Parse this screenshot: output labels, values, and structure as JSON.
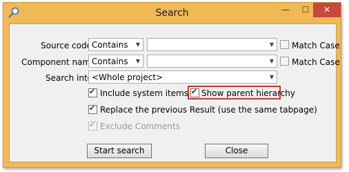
{
  "window": {
    "title": "Search",
    "icon": "search-icon"
  },
  "titlebar_buttons": {
    "minimize": "—",
    "maximize": "☐",
    "close": "✕"
  },
  "form": {
    "source_code": {
      "label": "Source code:",
      "mode": "Contains",
      "value": "",
      "match_case_label": "Match Case",
      "match_case": false
    },
    "component_name": {
      "label": "Component name:",
      "mode": "Contains",
      "value": "",
      "match_case_label": "Match Case",
      "match_case": false
    },
    "search_into": {
      "label": "Search into:",
      "value": "<Whole project>"
    },
    "include_system_items": {
      "label": "Include system items",
      "checked": true
    },
    "show_parent_hierarchy": {
      "label": "Show parent hierarchy",
      "checked": true
    },
    "replace_previous": {
      "label": "Replace the previous Result (use the same tabpage)",
      "checked": true
    },
    "exclude_comments": {
      "label": "Exclude Comments",
      "checked": true,
      "enabled": false
    }
  },
  "buttons": {
    "start_search": "Start search",
    "close": "Close"
  },
  "colors": {
    "frame": "#f0b955",
    "close_button": "#c7483d",
    "highlight": "#c0392b",
    "dialog_bg": "#f0f0f0"
  }
}
